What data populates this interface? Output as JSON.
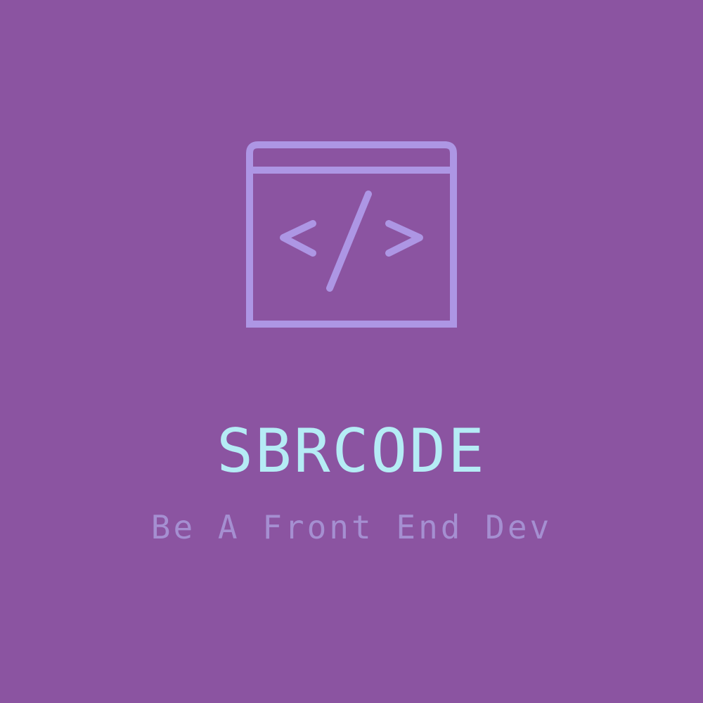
{
  "logo": {
    "icon": "code-window-icon",
    "brand_name": "SBRCODE",
    "tagline": "Be A Front End Dev"
  },
  "colors": {
    "background": "#8b54a1",
    "icon_stroke": "#ad96e4",
    "brand_name": "#b5ecf5",
    "tagline": "#a58fd1"
  }
}
